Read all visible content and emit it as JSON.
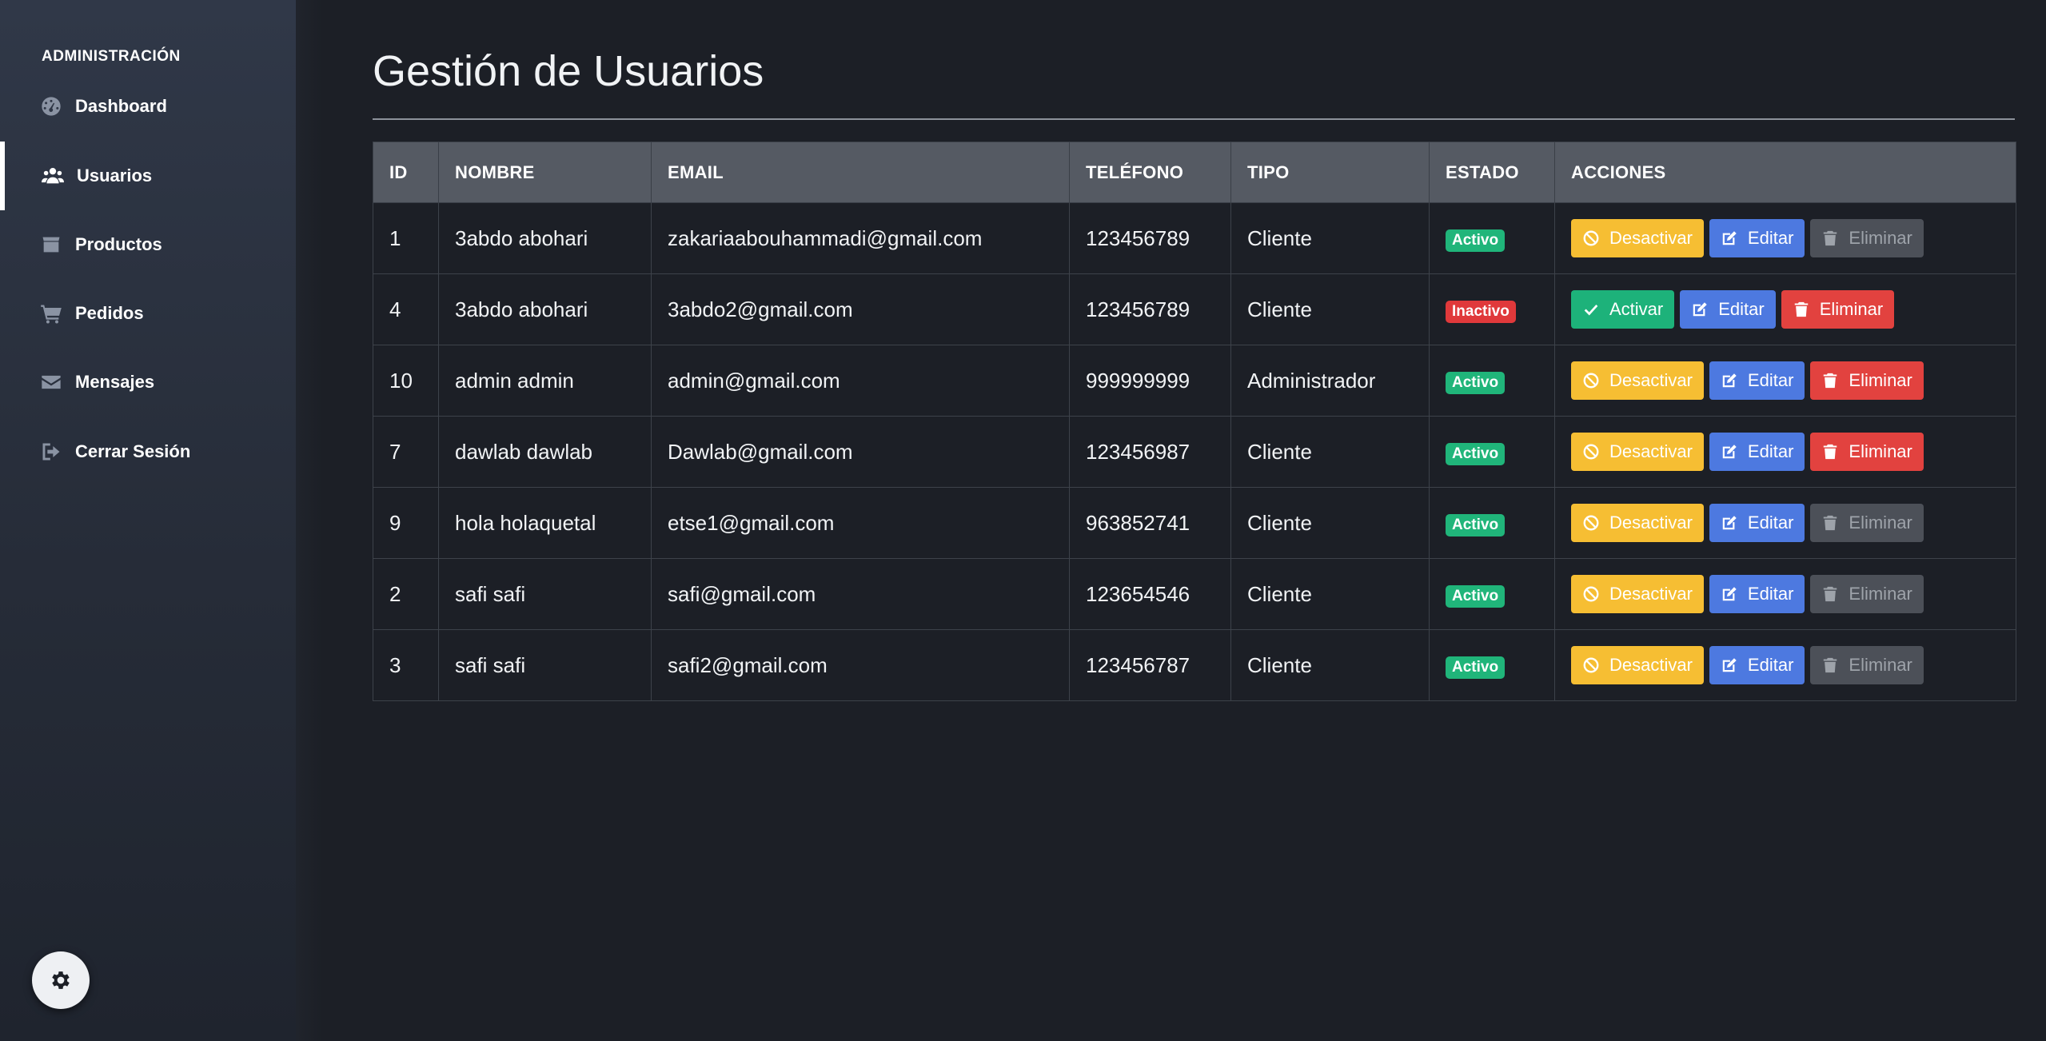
{
  "sidebar": {
    "heading": "ADMINISTRACIÓN",
    "items": [
      {
        "label": "Dashboard",
        "icon": "dashboard-icon"
      },
      {
        "label": "Usuarios",
        "icon": "users-icon",
        "active": true
      },
      {
        "label": "Productos",
        "icon": "box-icon"
      },
      {
        "label": "Pedidos",
        "icon": "cart-icon"
      },
      {
        "label": "Mensajes",
        "icon": "envelope-icon"
      },
      {
        "label": "Cerrar Sesión",
        "icon": "logout-icon"
      }
    ],
    "settings_icon": "gear-icon"
  },
  "main": {
    "title": "Gestión de Usuarios"
  },
  "table": {
    "headers": [
      "ID",
      "NOMBRE",
      "EMAIL",
      "TELÉFONO",
      "TIPO",
      "ESTADO",
      "ACCIONES"
    ],
    "rows": [
      {
        "id": "1",
        "nombre": "3abdo abohari",
        "email": "zakariaabouhammadi@gmail.com",
        "telefono": "123456789",
        "tipo": "Cliente",
        "estado": "Activo",
        "toggle": "Desactivar",
        "edit": "Editar",
        "delete": "Eliminar",
        "delete_enabled": false
      },
      {
        "id": "4",
        "nombre": "3abdo abohari",
        "email": "3abdo2@gmail.com",
        "telefono": "123456789",
        "tipo": "Cliente",
        "estado": "Inactivo",
        "toggle": "Activar",
        "edit": "Editar",
        "delete": "Eliminar",
        "delete_enabled": true
      },
      {
        "id": "10",
        "nombre": "admin admin",
        "email": "admin@gmail.com",
        "telefono": "999999999",
        "tipo": "Administrador",
        "estado": "Activo",
        "toggle": "Desactivar",
        "edit": "Editar",
        "delete": "Eliminar",
        "delete_enabled": true
      },
      {
        "id": "7",
        "nombre": "dawlab dawlab",
        "email": "Dawlab@gmail.com",
        "telefono": "123456987",
        "tipo": "Cliente",
        "estado": "Activo",
        "toggle": "Desactivar",
        "edit": "Editar",
        "delete": "Eliminar",
        "delete_enabled": true
      },
      {
        "id": "9",
        "nombre": "hola holaquetal",
        "email": "etse1@gmail.com",
        "telefono": "963852741",
        "tipo": "Cliente",
        "estado": "Activo",
        "toggle": "Desactivar",
        "edit": "Editar",
        "delete": "Eliminar",
        "delete_enabled": false
      },
      {
        "id": "2",
        "nombre": "safi safi",
        "email": "safi@gmail.com",
        "telefono": "123654546",
        "tipo": "Cliente",
        "estado": "Activo",
        "toggle": "Desactivar",
        "edit": "Editar",
        "delete": "Eliminar",
        "delete_enabled": false
      },
      {
        "id": "3",
        "nombre": "safi safi",
        "email": "safi2@gmail.com",
        "telefono": "123456787",
        "tipo": "Cliente",
        "estado": "Activo",
        "toggle": "Desactivar",
        "edit": "Editar",
        "delete": "Eliminar",
        "delete_enabled": false
      }
    ]
  },
  "colors": {
    "background": "#1c1f26",
    "header_bg": "#555a63",
    "warning": "#f6be33",
    "success": "#1db27a",
    "primary": "#4d79e0",
    "danger": "#e2423f",
    "disabled": "#4c5058"
  }
}
